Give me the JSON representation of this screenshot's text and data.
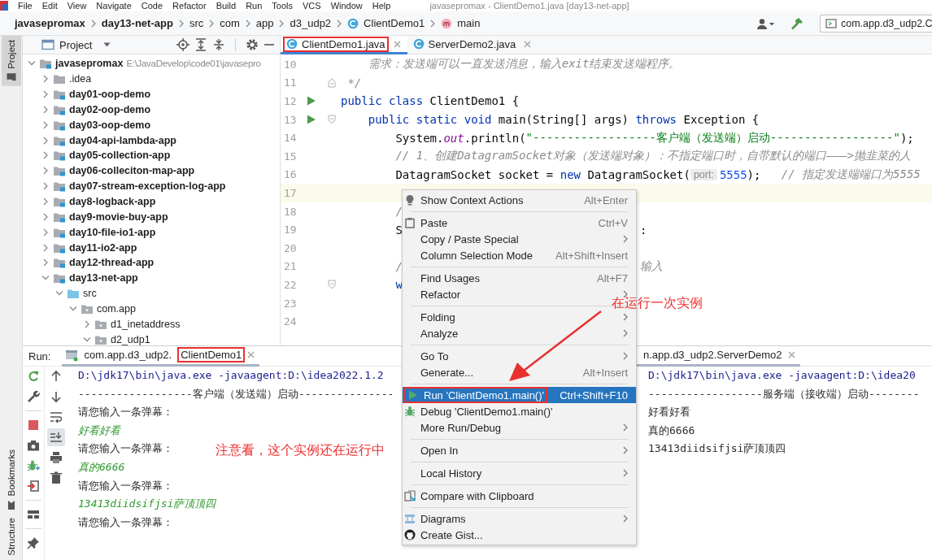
{
  "title_bar": {
    "menu": [
      "File",
      "Edit",
      "View",
      "Navigate",
      "Code",
      "Refactor",
      "Build",
      "Run",
      "Tools",
      "VCS",
      "Window",
      "Help"
    ],
    "title": "javasepromax - ClientDemo1.java [day13-net-app]"
  },
  "breadcrumbs": [
    {
      "label": "javasepromax",
      "kind": "project"
    },
    {
      "label": "day13-net-app",
      "kind": "module"
    },
    {
      "label": "src",
      "kind": "folder"
    },
    {
      "label": "com",
      "kind": "folder"
    },
    {
      "label": "app",
      "kind": "folder"
    },
    {
      "label": "d3_udp2",
      "kind": "folder"
    },
    {
      "label": "ClientDemo1",
      "kind": "class"
    },
    {
      "label": "main",
      "kind": "method"
    }
  ],
  "run_config": {
    "value": "com.app.d3_udp2.C"
  },
  "tool_strip": {
    "top": [
      {
        "label": "Project",
        "selected": true
      }
    ],
    "bottom": [
      {
        "label": "Bookmarks",
        "selected": false
      },
      {
        "label": "Structure",
        "selected": false
      }
    ]
  },
  "project_panel": {
    "title": "Project",
    "tree": [
      {
        "label": "javasepromax",
        "path": "E:\\JavaDevelop\\code01\\javasepro",
        "kind": "module",
        "expanded": true,
        "children": [
          {
            "label": ".idea",
            "kind": "folder",
            "expanded": false
          },
          {
            "label": "day01-oop-demo",
            "kind": "module",
            "expanded": false
          },
          {
            "label": "day02-oop-demo",
            "kind": "module",
            "expanded": false
          },
          {
            "label": "day03-oop-demo",
            "kind": "module",
            "expanded": false
          },
          {
            "label": "day04-api-lambda-app",
            "kind": "module",
            "expanded": false
          },
          {
            "label": "day05-collection-app",
            "kind": "module",
            "expanded": false
          },
          {
            "label": "day06-colleciton-map-app",
            "kind": "module",
            "expanded": false
          },
          {
            "label": "day07-stream-exception-log-app",
            "kind": "module",
            "expanded": false
          },
          {
            "label": "day8-logback-app",
            "kind": "module",
            "expanded": false
          },
          {
            "label": "day9-movie-buy-app",
            "kind": "module",
            "expanded": false
          },
          {
            "label": "day10-file-io1-app",
            "kind": "module",
            "expanded": false
          },
          {
            "label": "day11-io2-app",
            "kind": "module",
            "expanded": false
          },
          {
            "label": "day12-thread-app",
            "kind": "module",
            "expanded": false
          },
          {
            "label": "day13-net-app",
            "kind": "module",
            "expanded": true,
            "children": [
              {
                "label": "src",
                "kind": "source",
                "expanded": true,
                "children": [
                  {
                    "label": "com.app",
                    "kind": "package",
                    "expanded": true,
                    "children": [
                      {
                        "label": "d1_inetaddress",
                        "kind": "package",
                        "expanded": false
                      },
                      {
                        "label": "d2_udp1",
                        "kind": "package",
                        "expanded": true
                      }
                    ]
                  }
                ]
              }
            ]
          }
        ]
      }
    ]
  },
  "editor": {
    "tabs": [
      {
        "label": "ClientDemo1.java",
        "selected": true,
        "annotated": true
      },
      {
        "label": "ServerDemo2.java",
        "selected": false,
        "annotated": false
      }
    ],
    "lines": [
      {
        "number": "10",
        "run": false,
        "current": false,
        "segments": [
          {
            "kind": "comment",
            "text": "    需求：发送端可以一直发送消息，输入exit结束发送端程序。"
          }
        ]
      },
      {
        "number": "11",
        "run": false,
        "current": false,
        "fold_marker": {
          "kind": "end"
        },
        "segments": [
          {
            "kind": "comment",
            "text": " */"
          }
        ]
      },
      {
        "number": "12",
        "run": true,
        "current": false,
        "segments": [
          {
            "kind": "keyword",
            "text": "public class "
          },
          {
            "kind": "plain",
            "text": "ClientDemo1 {"
          }
        ]
      },
      {
        "number": "13",
        "run": true,
        "current": false,
        "fold_marker": {
          "kind": "start"
        },
        "segments": [
          {
            "kind": "keyword",
            "text": "    public static void "
          },
          {
            "kind": "plain",
            "text": "main(String[] args) "
          },
          {
            "kind": "keyword",
            "text": "throws "
          },
          {
            "kind": "plain",
            "text": "Exception {"
          }
        ]
      },
      {
        "number": "14",
        "run": false,
        "current": false,
        "segments": [
          {
            "kind": "plain",
            "text": "        System."
          },
          {
            "kind": "field",
            "text": "out"
          },
          {
            "kind": "plain",
            "text": ".println("
          },
          {
            "kind": "string",
            "text": "\"------------------客户端（发送端）启动------------------\""
          },
          {
            "kind": "plain",
            "text": ");"
          }
        ]
      },
      {
        "number": "15",
        "run": false,
        "current": false,
        "segments": [
          {
            "kind": "comment",
            "text": "        // 1、创建DatagramSocket对象（发送端对象）：不指定端口时，自带默认的端口———>抛韭菜的人"
          }
        ]
      },
      {
        "number": "16",
        "run": false,
        "current": false,
        "segments": [
          {
            "kind": "plain",
            "text": "        DatagramSocket socket = "
          },
          {
            "kind": "keyword",
            "text": "new "
          },
          {
            "kind": "plain",
            "text": "DatagramSocket("
          },
          {
            "kind": "hint",
            "text": "port:"
          },
          {
            "kind": "number",
            "text": "5555"
          },
          {
            "kind": "plain",
            "text": ");"
          },
          {
            "kind": "comment",
            "text": "   // 指定发送端端口为5555"
          }
        ]
      },
      {
        "number": "17",
        "run": false,
        "current": true
      },
      {
        "number": "18",
        "run": false,
        "current": false,
        "segments": [
          {
            "kind": "comment",
            "text": "        /"
          }
        ]
      },
      {
        "number": "19",
        "run": false,
        "current": false,
        "segments": [
          {
            "kind": "plain",
            "text": "        S"
          }
        ],
        "tail": [
          {
            "kind": "plain",
            "text": ":"
          }
        ]
      },
      {
        "number": "20",
        "run": false,
        "current": false
      },
      {
        "number": "21",
        "run": false,
        "current": false,
        "segments": [
          {
            "kind": "comment",
            "text": "        /"
          }
        ],
        "tail": [
          {
            "kind": "comment",
            "text": "输入"
          }
        ]
      },
      {
        "number": "22",
        "run": false,
        "current": false,
        "fold_marker": {
          "kind": "start"
        },
        "segments": [
          {
            "kind": "keyword",
            "text": "        w"
          }
        ]
      },
      {
        "number": "23",
        "run": false,
        "current": false
      },
      {
        "number": "24",
        "run": false,
        "current": false
      }
    ]
  },
  "run_panel": {
    "title": "Run:",
    "scroll_to_end_on": true,
    "consoles": [
      {
        "selected": true,
        "tab": [
          {
            "text": "com.app.d3_udp2.",
            "annotated": false
          },
          {
            "text": "ClientDemo1",
            "annotated": true
          }
        ],
        "lines": [
          {
            "kind": "command",
            "text": "D:\\jdk17\\bin\\java.exe -javaagent:D:\\idea2022.1.2"
          },
          {
            "kind": "output",
            "text": "------------------客户端（发送端）启动---------------"
          },
          {
            "kind": "output",
            "text": "请您输入一条弹幕："
          },
          {
            "kind": "input",
            "text": "好看好看"
          },
          {
            "kind": "output",
            "text": "请您输入一条弹幕："
          },
          {
            "kind": "input",
            "text": "真的6666"
          },
          {
            "kind": "output",
            "text": "请您输入一条弹幕："
          },
          {
            "kind": "input",
            "text": "13413diidsifjsi萨顶顶四"
          },
          {
            "kind": "output",
            "text": "请您输入一条弹幕："
          }
        ]
      },
      {
        "selected": true,
        "tab": [
          {
            "text": "n.app.d3_udp2.ServerDemo2",
            "annotated": false
          }
        ],
        "lines": [
          {
            "kind": "command",
            "text": "D:\\jdk17\\bin\\java.exe -javaagent:D:\\idea20"
          },
          {
            "kind": "output",
            "text": "------------------服务端（接收端）启动--------"
          },
          {
            "kind": "output",
            "text": "好看好看"
          },
          {
            "kind": "output",
            "text": "真的6666"
          },
          {
            "kind": "output",
            "text": "13413diidsifjsi萨顶顶四"
          }
        ]
      }
    ]
  },
  "context_menu": {
    "items": [
      {
        "kind": "item",
        "label": "Show Context Actions",
        "shortcut": "Alt+Enter",
        "submenu": false,
        "selected": false,
        "annotated": false
      },
      {
        "kind": "separator"
      },
      {
        "kind": "item",
        "label": "Paste",
        "shortcut": "Ctrl+V",
        "submenu": false,
        "selected": false,
        "annotated": false
      },
      {
        "kind": "item",
        "label": "Copy / Paste Special",
        "submenu": true,
        "selected": false,
        "annotated": false
      },
      {
        "kind": "item",
        "label": "Column Selection Mode",
        "shortcut": "Alt+Shift+Insert",
        "submenu": false,
        "selected": false,
        "annotated": false
      },
      {
        "kind": "separator"
      },
      {
        "kind": "item",
        "label": "Find Usages",
        "shortcut": "Alt+F7",
        "submenu": false,
        "selected": false,
        "annotated": false
      },
      {
        "kind": "item",
        "label": "Refactor",
        "submenu": true,
        "selected": false,
        "annotated": false
      },
      {
        "kind": "separator"
      },
      {
        "kind": "item",
        "label": "Folding",
        "submenu": true,
        "selected": false,
        "annotated": false
      },
      {
        "kind": "item",
        "label": "Analyze",
        "submenu": true,
        "selected": false,
        "annotated": false
      },
      {
        "kind": "separator"
      },
      {
        "kind": "item",
        "label": "Go To",
        "submenu": true,
        "selected": false,
        "annotated": false
      },
      {
        "kind": "item",
        "label": "Generate...",
        "shortcut": "Alt+Insert",
        "submenu": false,
        "selected": false,
        "annotated": false
      },
      {
        "kind": "separator"
      },
      {
        "kind": "item",
        "label": "Run 'ClientDemo1.main()'",
        "shortcut": "Ctrl+Shift+F10",
        "submenu": false,
        "selected": true,
        "annotated": true
      },
      {
        "kind": "item",
        "label": "Debug 'ClientDemo1.main()'",
        "submenu": false,
        "selected": false,
        "annotated": false
      },
      {
        "kind": "item",
        "label": "More Run/Debug",
        "submenu": true,
        "selected": false,
        "annotated": false
      },
      {
        "kind": "separator"
      },
      {
        "kind": "item",
        "label": "Open In",
        "submenu": true,
        "selected": false,
        "annotated": false
      },
      {
        "kind": "separator"
      },
      {
        "kind": "item",
        "label": "Local History",
        "submenu": true,
        "selected": false,
        "annotated": false
      },
      {
        "kind": "separator"
      },
      {
        "kind": "item",
        "label": "Compare with Clipboard",
        "submenu": false,
        "selected": false,
        "annotated": false
      },
      {
        "kind": "separator"
      },
      {
        "kind": "item",
        "label": "Diagrams",
        "submenu": true,
        "selected": false,
        "annotated": false
      },
      {
        "kind": "item",
        "label": "Create Gist...",
        "submenu": false,
        "selected": false,
        "annotated": false
      }
    ]
  },
  "annotations": [
    {
      "kind": "callout",
      "text": "在运行一次实例"
    },
    {
      "kind": "callout",
      "text": "注意看，这个实例还在运行中"
    }
  ]
}
